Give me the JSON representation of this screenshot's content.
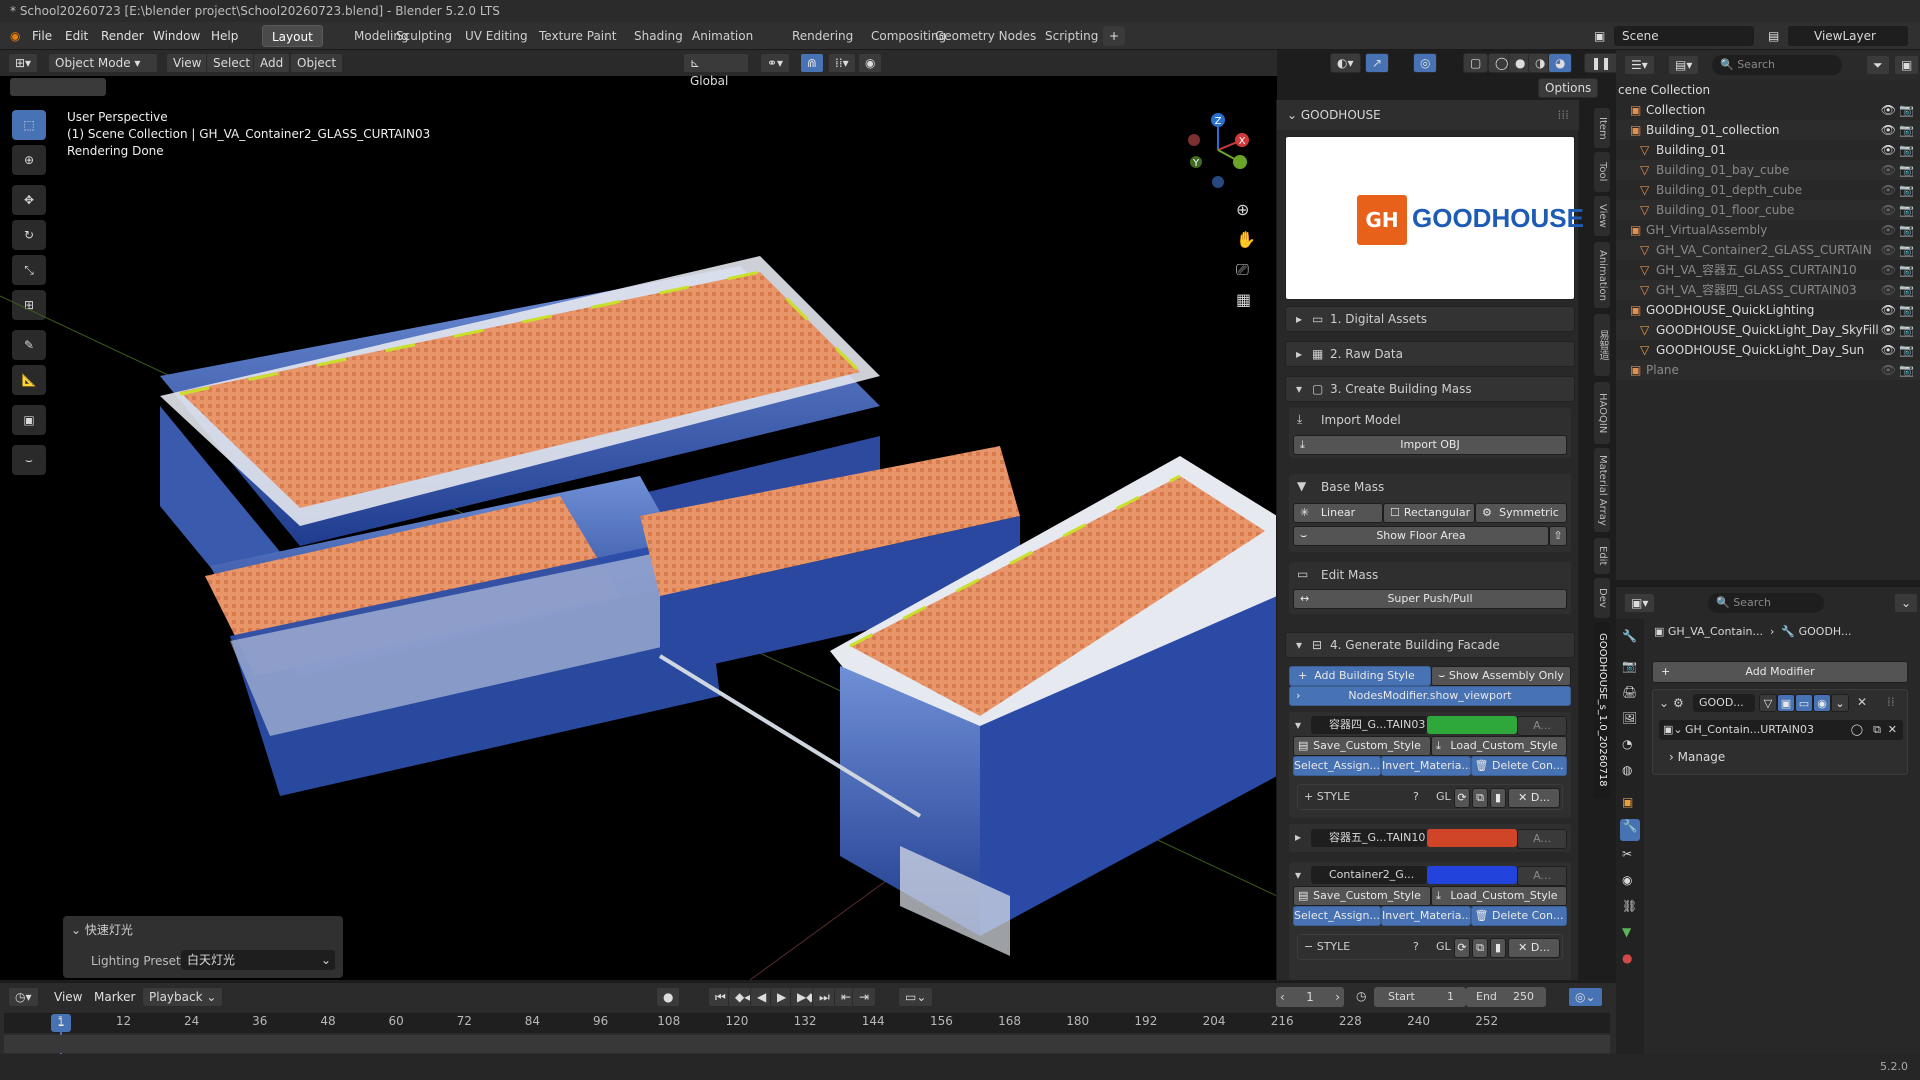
{
  "title_bar": "* School20260723 [E:\\blender project\\School20260723.blend] - Blender 5.2.0 LTS",
  "menu": {
    "items": [
      "File",
      "Edit",
      "Render",
      "Window",
      "Help"
    ]
  },
  "workspaces": [
    "Layout",
    "Modeling",
    "Sculpting",
    "UV Editing",
    "Texture Paint",
    "Shading",
    "Animation",
    "Rendering",
    "Compositing",
    "Geometry Nodes",
    "Scripting"
  ],
  "active_workspace": "Layout",
  "scene": {
    "name": "Scene",
    "view_layer": "ViewLayer"
  },
  "viewport": {
    "mode": "Object Mode",
    "menus": [
      "View",
      "Select",
      "Add",
      "Object"
    ],
    "orientation": "Global",
    "options": "Options",
    "overlay_lines": [
      "User Perspective",
      "(1) Scene Collection | GH_VA_Container2_GLASS_CURTAIN03",
      "Rendering Done"
    ],
    "gizmo": {
      "z": "Z",
      "x": "X",
      "y": "Y"
    }
  },
  "quick_light": {
    "title": "快速灯光",
    "label": "Lighting Preset",
    "value": "白天灯光"
  },
  "npanel": {
    "header": "GOODHOUSE",
    "logo_text": "GOODHOUSE",
    "logo_mark": "GH",
    "sections": [
      "1. Digital Assets",
      "2. Raw Data",
      "3. Create Building Mass"
    ],
    "import_model": "Import Model",
    "import_obj": "Import OBJ",
    "base_mass": "Base Mass",
    "linear": "Linear",
    "rectangular": "Rectangular",
    "symmetric": "Symmetric",
    "show_floor_area": "Show Floor Area",
    "edit_mass": "Edit Mass",
    "super_push": "Super Push/Pull",
    "facade": "4. Generate Building Facade",
    "add_style": "Add Building Style",
    "show_assembly": "Show Assembly Only",
    "nodes_mod": "NodesModifier.show_viewport",
    "styles": [
      {
        "name": "容器四_G...TAIN03",
        "color": "#2ea83a",
        "extra": "A...",
        "save": "Save_Custom_Style",
        "load": "Load_Custom_Style",
        "sel": "Select_Assign...",
        "inv": "Invert_Materia...",
        "del": "Delete Con...",
        "style": "STYLE",
        "gl": "GL",
        "d": "D..."
      },
      {
        "name": "容器五_G...TAIN10",
        "color": "#d04428",
        "extra": "A..."
      },
      {
        "name": "Container2_G...",
        "color": "#2244dd",
        "extra": "A...",
        "save": "Save_Custom_Style",
        "load": "Load_Custom_Style",
        "sel": "Select_Assign...",
        "inv": "Invert_Materia...",
        "del": "Delete Con...",
        "style": "STYLE",
        "gl": "GL",
        "d": "D..."
      }
    ],
    "side_tabs": [
      "Item",
      "Tool",
      "View",
      "Animation",
      "易智造",
      "HAOQIN",
      "Material Array",
      "Edit",
      "Dev",
      "GOODHOUSE_s_1.0_20260718"
    ]
  },
  "outliner": {
    "search": "Search",
    "root": "cene Collection",
    "rows": [
      {
        "name": "Collection",
        "level": 0,
        "dim": false
      },
      {
        "name": "Building_01_collection",
        "level": 0,
        "dim": false
      },
      {
        "name": "Building_01",
        "level": 1,
        "dim": false
      },
      {
        "name": "Building_01_bay_cube",
        "level": 1,
        "dim": true
      },
      {
        "name": "Building_01_depth_cube",
        "level": 1,
        "dim": true
      },
      {
        "name": "Building_01_floor_cube",
        "level": 1,
        "dim": true
      },
      {
        "name": "GH_VirtualAssembly",
        "level": 0,
        "dim": true
      },
      {
        "name": "GH_VA_Container2_GLASS_CURTAIN",
        "level": 1,
        "dim": true
      },
      {
        "name": "GH_VA_容器五_GLASS_CURTAIN10",
        "level": 1,
        "dim": true
      },
      {
        "name": "GH_VA_容器四_GLASS_CURTAIN03",
        "level": 1,
        "dim": true
      },
      {
        "name": "GOODHOUSE_QuickLighting",
        "level": 0,
        "dim": false
      },
      {
        "name": "GOODHOUSE_QuickLight_Day_SkyFill",
        "level": 1,
        "dim": false
      },
      {
        "name": "GOODHOUSE_QuickLight_Day_Sun",
        "level": 1,
        "dim": false
      },
      {
        "name": "Plane",
        "level": 0,
        "dim": true
      }
    ]
  },
  "properties": {
    "search": "Search",
    "breadcrumb_obj": "GH_VA_Contain...",
    "breadcrumb_mod": "GOODH...",
    "add_modifier": "Add Modifier",
    "modifier_name": "GOOD...",
    "node_group": "GH_Contain...URTAIN03",
    "manage": "Manage"
  },
  "timeline": {
    "menus": [
      "View",
      "Marker",
      "Playback"
    ],
    "current_frame": "1",
    "start_label": "Start",
    "start": "1",
    "end_label": "End",
    "end": "250",
    "ticks": [
      "1",
      "12",
      "24",
      "36",
      "48",
      "60",
      "72",
      "84",
      "96",
      "108",
      "120",
      "132",
      "144",
      "156",
      "168",
      "180",
      "192",
      "204",
      "216",
      "228",
      "240",
      "252"
    ]
  },
  "version": "5.2.0"
}
